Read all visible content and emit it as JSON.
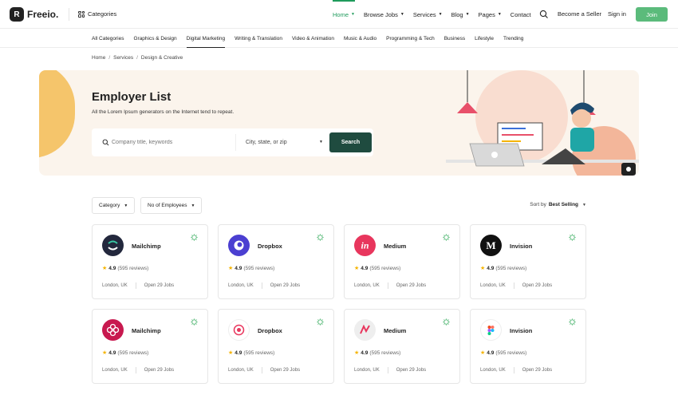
{
  "header": {
    "logo_text": "Freeio.",
    "logo_mark": "R",
    "categories_label": "Categories",
    "nav": [
      {
        "label": "Home",
        "active": true,
        "dropdown": true
      },
      {
        "label": "Browse Jobs",
        "active": false,
        "dropdown": true
      },
      {
        "label": "Services",
        "active": false,
        "dropdown": true
      },
      {
        "label": "Blog",
        "active": false,
        "dropdown": true
      },
      {
        "label": "Pages",
        "active": false,
        "dropdown": true
      },
      {
        "label": "Contact",
        "active": false,
        "dropdown": false
      }
    ],
    "become_seller": "Become a Seller",
    "signin": "Sign in",
    "join": "Join",
    "accent": "#5bbb7b"
  },
  "category_bar": [
    {
      "label": "All Categories",
      "active": false
    },
    {
      "label": "Graphics & Design",
      "active": false
    },
    {
      "label": "Digital Marketing",
      "active": true
    },
    {
      "label": "Writing & Translation",
      "active": false
    },
    {
      "label": "Video & Animation",
      "active": false
    },
    {
      "label": "Music & Audio",
      "active": false
    },
    {
      "label": "Programming & Tech",
      "active": false
    },
    {
      "label": "Business",
      "active": false
    },
    {
      "label": "Lifestyle",
      "active": false
    },
    {
      "label": "Trending",
      "active": false
    }
  ],
  "breadcrumb": [
    "Home",
    "Services",
    "Design & Creative"
  ],
  "hero": {
    "title": "Employer List",
    "subtitle": "All the Lorem Ipsum generators on the Internet tend to repeat.",
    "search_placeholder": "Company title, keywords",
    "location_placeholder": "City, state, or zip",
    "search_button": "Search",
    "button_color": "#1f4b3f"
  },
  "filters": {
    "category": "Category",
    "employees": "No of Employees",
    "sort_label": "Sort by",
    "sort_value": "Best Selling"
  },
  "cards": [
    {
      "name": "Mailchimp",
      "rating": "4.9",
      "reviews": "(595 reviews)",
      "location": "London, UK",
      "jobs": "Open 29 Jobs",
      "logo_color": "#23283d",
      "logo_icon": "mailchimp-icon"
    },
    {
      "name": "Dropbox",
      "rating": "4.9",
      "reviews": "(595 reviews)",
      "location": "London, UK",
      "jobs": "Open 29 Jobs",
      "logo_color": "#4b3fd1",
      "logo_icon": "dropbox-icon"
    },
    {
      "name": "Medium",
      "rating": "4.9",
      "reviews": "(595 reviews)",
      "location": "London, UK",
      "jobs": "Open 29 Jobs",
      "logo_color": "#e8365d",
      "logo_icon": "invision-in-icon"
    },
    {
      "name": "Invision",
      "rating": "4.9",
      "reviews": "(595 reviews)",
      "location": "London, UK",
      "jobs": "Open 29 Jobs",
      "logo_color": "#111111",
      "logo_icon": "medium-m-icon"
    },
    {
      "name": "Mailchimp",
      "rating": "4.9",
      "reviews": "(595 reviews)",
      "location": "London, UK",
      "jobs": "Open 29 Jobs",
      "logo_color": "#c8194f",
      "logo_icon": "flower-icon"
    },
    {
      "name": "Dropbox",
      "rating": "4.9",
      "reviews": "(595 reviews)",
      "location": "London, UK",
      "jobs": "Open 29 Jobs",
      "logo_color": "#ffffff",
      "logo_icon": "target-icon"
    },
    {
      "name": "Medium",
      "rating": "4.9",
      "reviews": "(595 reviews)",
      "location": "London, UK",
      "jobs": "Open 29 Jobs",
      "logo_color": "#eeeeee",
      "logo_icon": "swirl-icon"
    },
    {
      "name": "Invision",
      "rating": "4.9",
      "reviews": "(595 reviews)",
      "location": "London, UK",
      "jobs": "Open 29 Jobs",
      "logo_color": "#ffffff",
      "logo_icon": "figma-icon"
    }
  ]
}
